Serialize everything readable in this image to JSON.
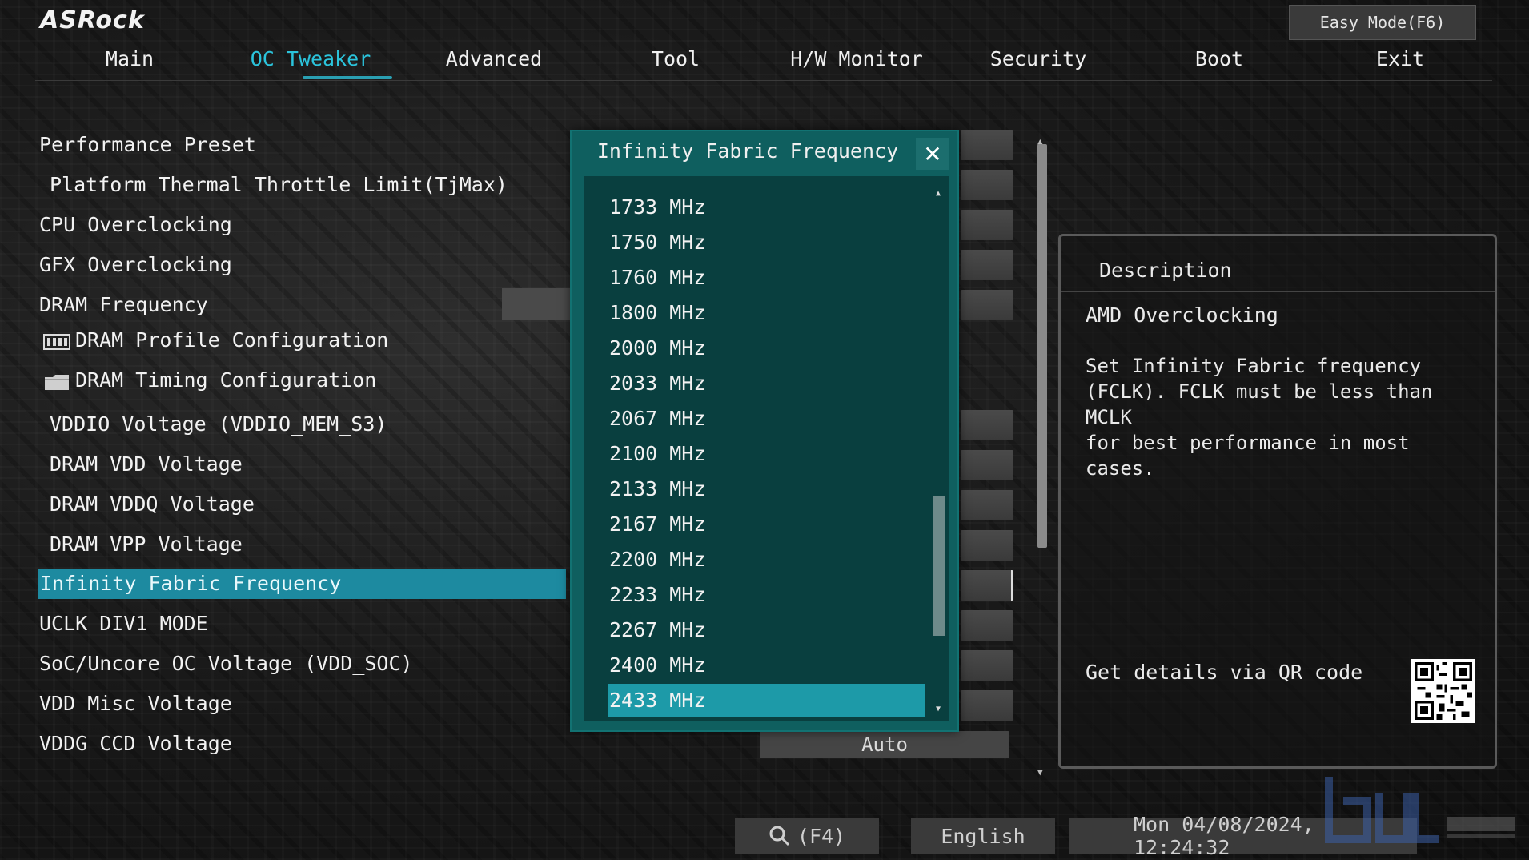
{
  "brand": {
    "logo": "ASRock"
  },
  "header": {
    "easy_mode": "Easy Mode(F6)"
  },
  "nav": {
    "tabs": [
      {
        "label": "Main"
      },
      {
        "label": "OC Tweaker"
      },
      {
        "label": "Advanced"
      },
      {
        "label": "Tool"
      },
      {
        "label": "H/W Monitor"
      },
      {
        "label": "Security"
      },
      {
        "label": "Boot"
      },
      {
        "label": "Exit"
      }
    ],
    "active": "OC Tweaker"
  },
  "menu": {
    "items": [
      {
        "label": "Performance Preset"
      },
      {
        "label": "Platform Thermal Throttle Limit(TjMax)"
      },
      {
        "label": "CPU Overclocking"
      },
      {
        "label": "GFX Overclocking"
      },
      {
        "label": "DRAM Frequency"
      },
      {
        "label": "DRAM Profile Configuration"
      },
      {
        "label": "DRAM Timing Configuration"
      },
      {
        "label": "VDDIO Voltage (VDDIO_MEM_S3)"
      },
      {
        "label": "DRAM VDD Voltage"
      },
      {
        "label": "DRAM VDDQ Voltage"
      },
      {
        "label": "DRAM VPP Voltage"
      },
      {
        "label": "Infinity Fabric Frequency"
      },
      {
        "label": "UCLK DIV1 MODE"
      },
      {
        "label": "SoC/Uncore OC Voltage (VDD_SOC)"
      },
      {
        "label": "VDD Misc Voltage"
      },
      {
        "label": "VDDG CCD Voltage"
      }
    ],
    "selected": "Infinity Fabric Frequency",
    "vddg_ccd_value": "Auto"
  },
  "popup": {
    "title": "Infinity Fabric Frequency",
    "close_icon": "close-icon",
    "options": [
      "1733 MHz",
      "1750 MHz",
      "1760 MHz",
      "1800 MHz",
      "2000 MHz",
      "2033 MHz",
      "2067 MHz",
      "2100 MHz",
      "2133 MHz",
      "2167 MHz",
      "2200 MHz",
      "2233 MHz",
      "2267 MHz",
      "2400 MHz",
      "2433 MHz"
    ],
    "selected": "2433 MHz"
  },
  "description": {
    "title": "Description",
    "subtitle": "AMD Overclocking",
    "body": "Set Infinity Fabric frequency\n(FCLK). FCLK must be less than MCLK\nfor best performance in most cases.",
    "qr_label": "Get details via QR code"
  },
  "bottom": {
    "search": "(F4)",
    "language": "English",
    "datetime": "Mon 04/08/2024, 12:24:32"
  },
  "colors": {
    "accent": "#2bc4dc",
    "selection": "#1d8aa0",
    "popup_bg": "#0f5f5f"
  }
}
